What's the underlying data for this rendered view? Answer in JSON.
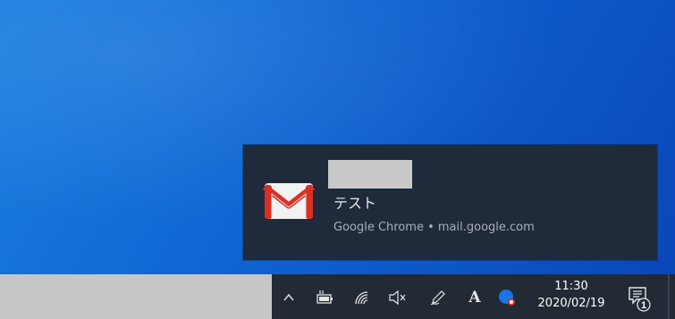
{
  "notification": {
    "app": "Gmail",
    "app_icon": "gmail-icon",
    "title": "テスト",
    "source": "Google Chrome • mail.google.com"
  },
  "taskbar": {
    "tray_icons": [
      "chevron-up-icon",
      "battery-icon",
      "wifi-icon",
      "volume-muted-icon",
      "pen-icon",
      "ime-icon",
      "browser-profile-icon"
    ],
    "ime_label": "A",
    "clock": {
      "time": "11:30",
      "date": "2020/02/19"
    },
    "notification_count": "1"
  },
  "colors": {
    "desktop": "#0f64d2",
    "toast_bg": "#1f2a3a",
    "taskbar": "#222a35",
    "gmail_red": "#d93025"
  }
}
